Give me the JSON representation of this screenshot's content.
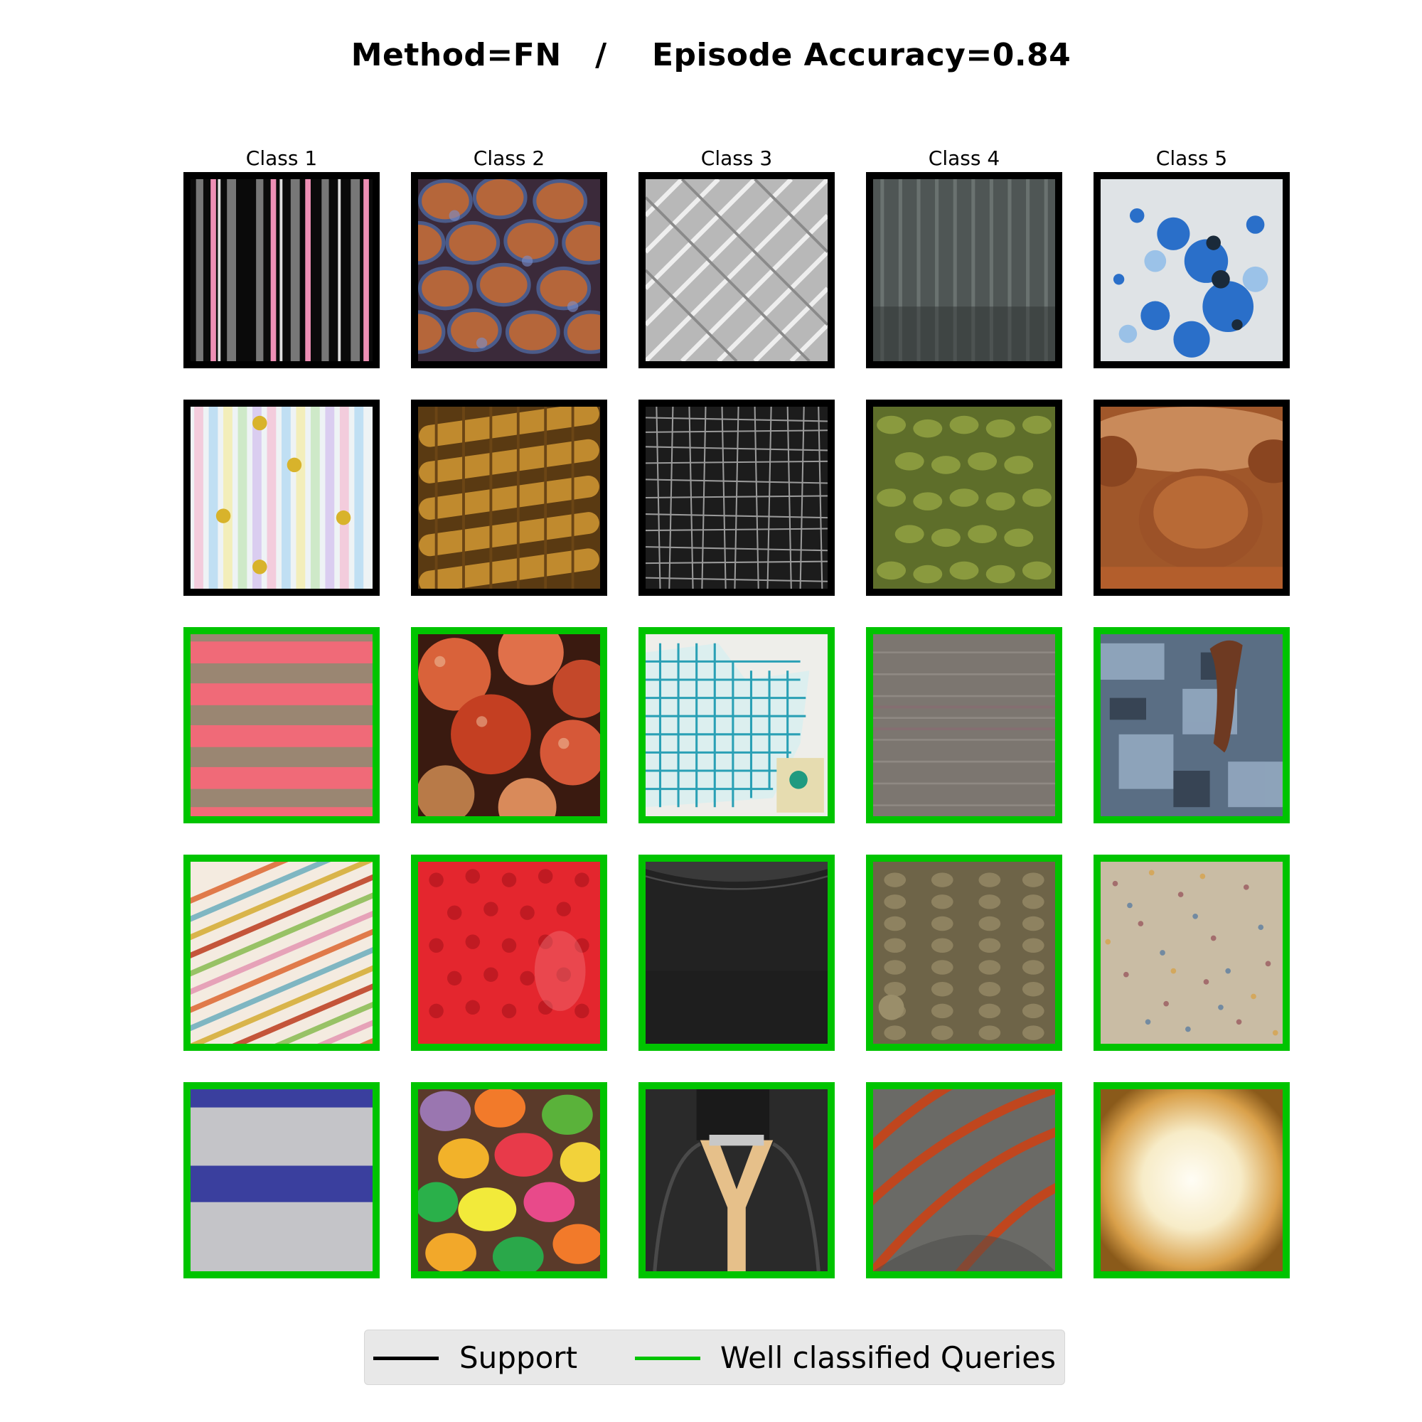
{
  "figure": {
    "title": "Method=FN   /    Episode Accuracy=0.84"
  },
  "columns": [
    "Class 1",
    "Class 2",
    "Class 3",
    "Class 4",
    "Class 5"
  ],
  "rows": [
    {
      "role": "support",
      "tiles": [
        "pink-gray vertical stripes",
        "scaly orange-blue dragon skin",
        "gray woven basket pattern",
        "dark gray knit fabric",
        "blue paint splatter on white"
      ]
    },
    {
      "role": "support",
      "tiles": [
        "pastel stripes with flowers",
        "brown beaded abacus rows",
        "black-white crosshatch",
        "green knitted wool",
        "chocolate truffle close-up"
      ]
    },
    {
      "role": "query",
      "tiles": [
        "pink-taupe horizontal stripes",
        "orange pumpkins",
        "teal grid on paper",
        "gray knitted fabric",
        "peeling blue paint with rust"
      ]
    },
    {
      "role": "query",
      "tiles": [
        "multicolor diagonal stripes",
        "red spiky ball surface",
        "black smooth leather",
        "brown chunky knit",
        "multicolor speckled surface"
      ]
    },
    {
      "role": "query",
      "tiles": [
        "blue-white horizontal stripes",
        "colorful candy pieces",
        "black leather bag with gold Y",
        "gray-orange knit diagonal",
        "grungy parchment texture"
      ]
    }
  ],
  "legend": {
    "support_label": "Support",
    "queries_label": "Well classified Queries",
    "support_color": "#000000",
    "queries_color": "#00c400"
  }
}
